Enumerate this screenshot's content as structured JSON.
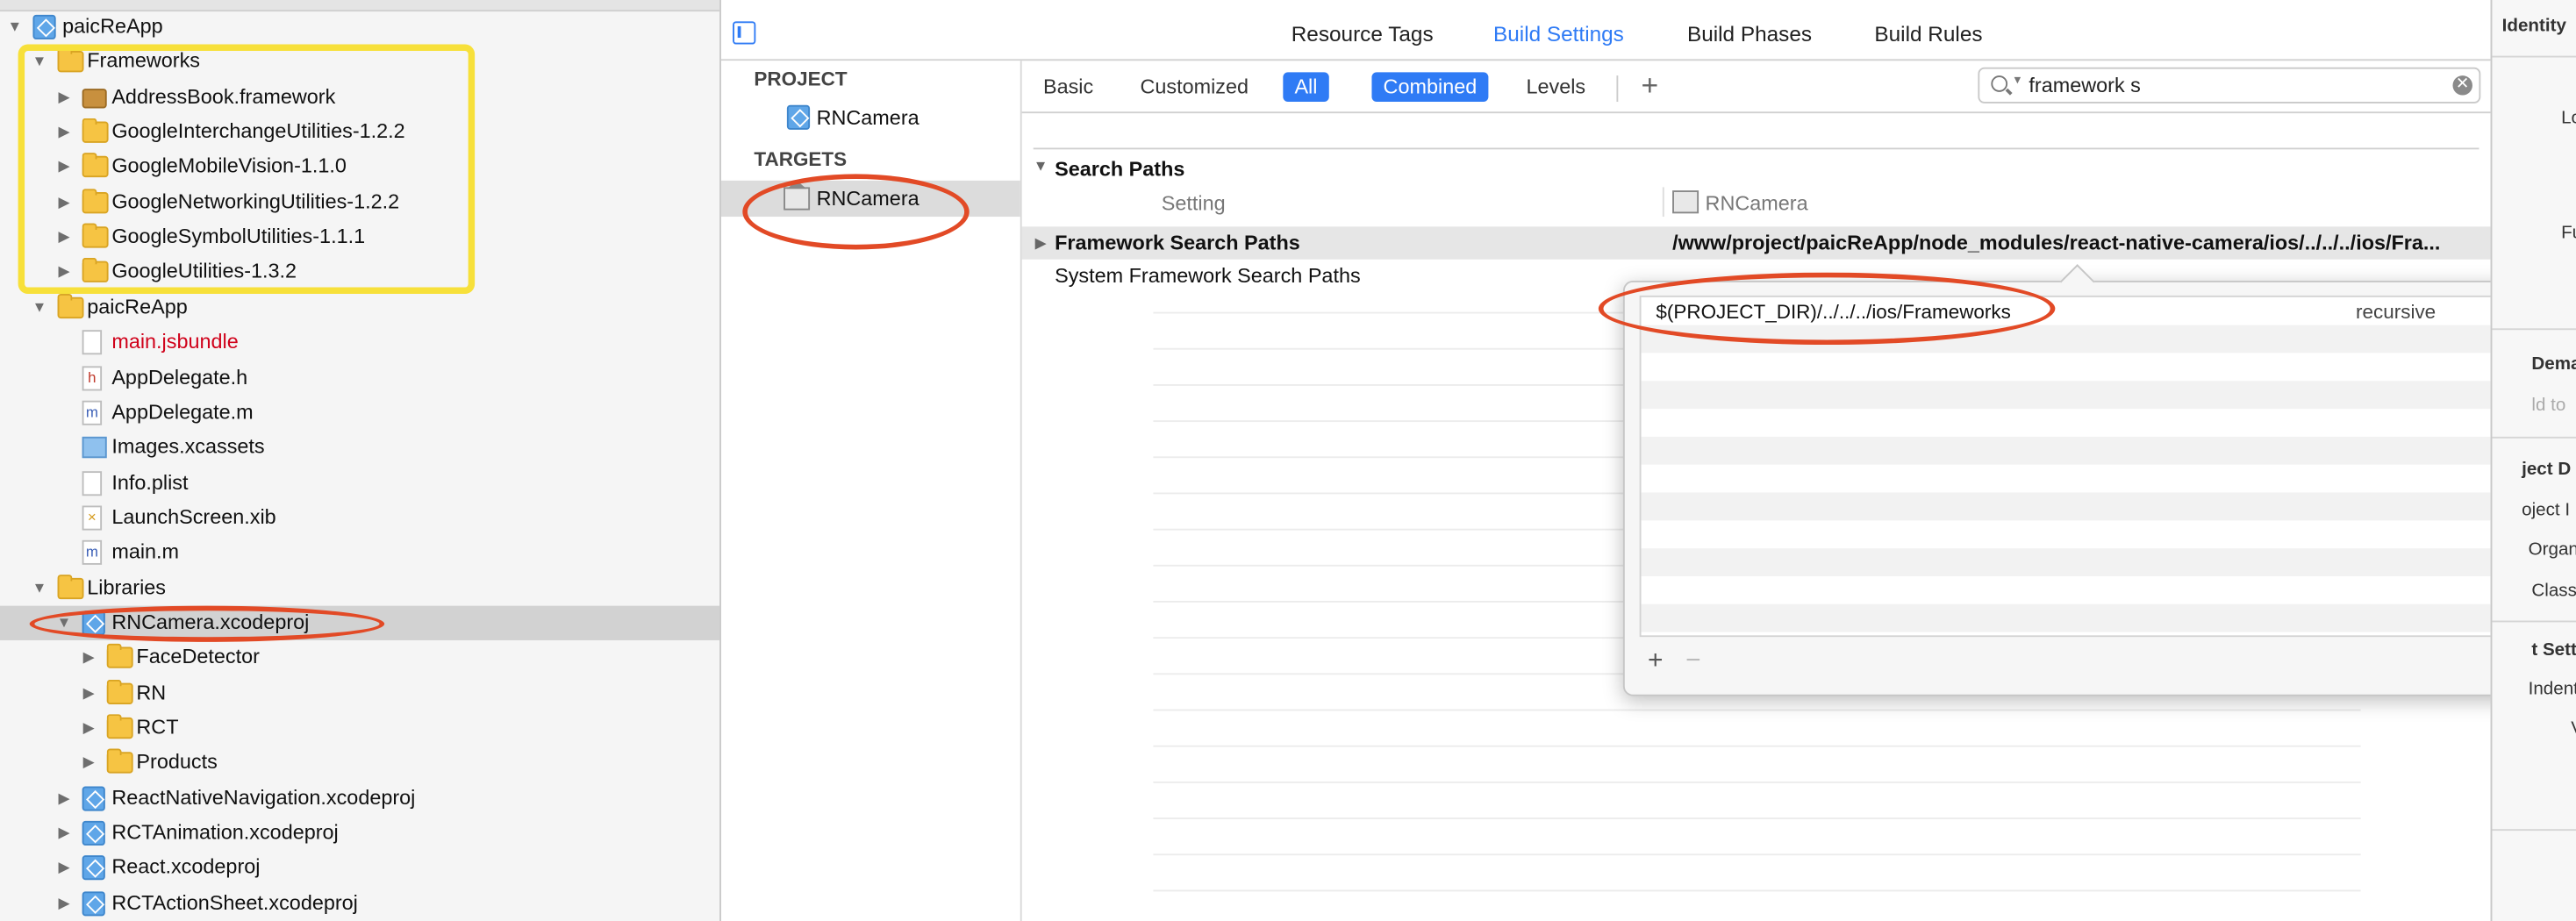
{
  "navigator": {
    "rows": [
      {
        "label": "paicReApp",
        "icon": "project-icon",
        "indent": 0,
        "disclosure": "open"
      },
      {
        "label": "Frameworks",
        "icon": "folder-icon",
        "indent": 1,
        "disclosure": "open"
      },
      {
        "label": "AddressBook.framework",
        "icon": "framework-icon",
        "indent": 2,
        "disclosure": "closed"
      },
      {
        "label": "GoogleInterchangeUtilities-1.2.2",
        "icon": "folder-icon",
        "indent": 2,
        "disclosure": "closed"
      },
      {
        "label": "GoogleMobileVision-1.1.0",
        "icon": "folder-icon",
        "indent": 2,
        "disclosure": "closed"
      },
      {
        "label": "GoogleNetworkingUtilities-1.2.2",
        "icon": "folder-icon",
        "indent": 2,
        "disclosure": "closed"
      },
      {
        "label": "GoogleSymbolUtilities-1.1.1",
        "icon": "folder-icon",
        "indent": 2,
        "disclosure": "closed"
      },
      {
        "label": "GoogleUtilities-1.3.2",
        "icon": "folder-icon",
        "indent": 2,
        "disclosure": "closed"
      },
      {
        "label": "paicReApp",
        "icon": "folder-icon",
        "indent": 1,
        "disclosure": "open"
      },
      {
        "label": "main.jsbundle",
        "icon": "file-icon",
        "indent": 2,
        "disclosure": "none",
        "missing": true
      },
      {
        "label": "AppDelegate.h",
        "icon": "header-file-icon",
        "indent": 2,
        "disclosure": "none"
      },
      {
        "label": "AppDelegate.m",
        "icon": "source-file-icon",
        "indent": 2,
        "disclosure": "none"
      },
      {
        "label": "Images.xcassets",
        "icon": "asset-catalog-icon",
        "indent": 2,
        "disclosure": "none"
      },
      {
        "label": "Info.plist",
        "icon": "plist-file-icon",
        "indent": 2,
        "disclosure": "none"
      },
      {
        "label": "LaunchScreen.xib",
        "icon": "xib-file-icon",
        "indent": 2,
        "disclosure": "none"
      },
      {
        "label": "main.m",
        "icon": "source-file-icon",
        "indent": 2,
        "disclosure": "none"
      },
      {
        "label": "Libraries",
        "icon": "folder-icon",
        "indent": 1,
        "disclosure": "open"
      },
      {
        "label": "RNCamera.xcodeproj",
        "icon": "project-icon",
        "indent": 2,
        "disclosure": "open",
        "selected": true
      },
      {
        "label": "FaceDetector",
        "icon": "folder-icon",
        "indent": 3,
        "disclosure": "closed"
      },
      {
        "label": "RN",
        "icon": "folder-icon",
        "indent": 3,
        "disclosure": "closed"
      },
      {
        "label": "RCT",
        "icon": "folder-icon",
        "indent": 3,
        "disclosure": "closed"
      },
      {
        "label": "Products",
        "icon": "folder-icon",
        "indent": 3,
        "disclosure": "closed"
      },
      {
        "label": "ReactNativeNavigation.xcodeproj",
        "icon": "project-icon",
        "indent": 2,
        "disclosure": "closed"
      },
      {
        "label": "RCTAnimation.xcodeproj",
        "icon": "project-icon",
        "indent": 2,
        "disclosure": "closed"
      },
      {
        "label": "React.xcodeproj",
        "icon": "project-icon",
        "indent": 2,
        "disclosure": "closed"
      },
      {
        "label": "RCTActionSheet.xcodeproj",
        "icon": "project-icon",
        "indent": 2,
        "disclosure": "closed"
      }
    ]
  },
  "editor": {
    "tabs": {
      "resource_tags": "Resource Tags",
      "build_settings": "Build Settings",
      "build_phases": "Build Phases",
      "build_rules": "Build Rules"
    },
    "project_header": "PROJECT",
    "project_item": "RNCamera",
    "targets_header": "TARGETS",
    "target_item": "RNCamera",
    "filters": {
      "basic": "Basic",
      "customized": "Customized",
      "all": "All",
      "combined": "Combined",
      "levels": "Levels",
      "add": "+"
    },
    "search": {
      "value": "framework s",
      "clear": "✕"
    },
    "section": {
      "title": "Search Paths",
      "col_setting": "Setting",
      "col_target": "RNCamera",
      "rows": [
        {
          "name": "Framework Search Paths",
          "value": "/www/project/paicReApp/node_modules/react-native-camera/ios/../../../ios/Fra..."
        },
        {
          "name": "System Framework Search Paths",
          "value": ""
        }
      ]
    }
  },
  "popover": {
    "entry_value": "$(PROJECT_DIR)/../../../ios/Frameworks",
    "entry_mode": "recursive",
    "stepper": "◇",
    "add": "+",
    "remove": "−"
  },
  "inspector": {
    "title": "Identity",
    "labels": [
      "Lo",
      "Fu",
      "Dema",
      "ld to",
      "ject D",
      "oject I",
      "Organ",
      "Class",
      "t Sett",
      "Indent",
      "V"
    ]
  },
  "colors": {
    "accent": "#2f7bf5",
    "highlight_yellow": "#f7e03a",
    "annotation_red": "#e24a26",
    "missing_file_red": "#d0021b"
  }
}
